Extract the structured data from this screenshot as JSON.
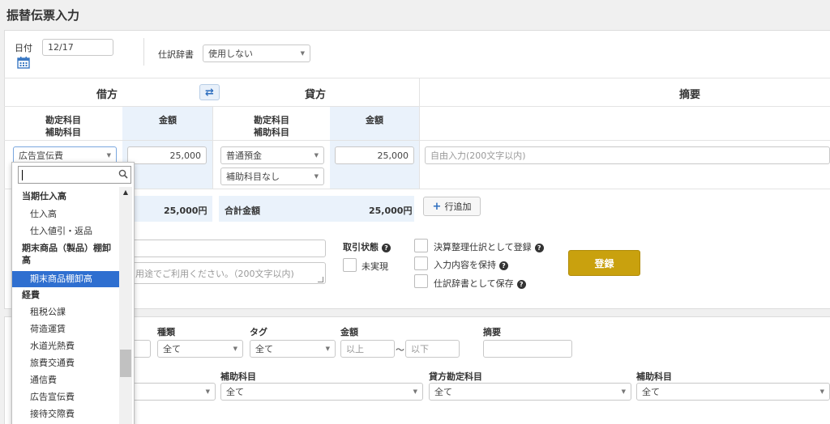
{
  "page_title": "振替伝票入力",
  "date_label": "日付",
  "date_value": "12/17",
  "dict_label": "仕訳辞書",
  "dict_value": "使用しない",
  "debit_header": "借方",
  "credit_header": "貸方",
  "memo_header": "摘要",
  "account_header_1": "勘定科目",
  "account_header_2": "補助科目",
  "amount_header": "金額",
  "debit_account": "広告宣伝費",
  "debit_amount": "25,000",
  "credit_account": "普通預金",
  "credit_sub": "補助科目なし",
  "credit_amount": "25,000",
  "memo_placeholder": "自由入力(200文字以内)",
  "total_debit": "25,000円",
  "total_label": "合計金額",
  "total_credit": "25,000円",
  "add_row": "行追加",
  "remark_placeholder": "用途でご利用ください。（200文字以内)",
  "status_label": "取引状態",
  "status_unsettled": "未実現",
  "opt_closing": "決算整理仕訳として登録",
  "opt_keep": "入力内容を保持",
  "opt_dict": "仕訳辞書として保存",
  "register": "登録",
  "filter": {
    "type_label": "種類",
    "type_value": "全て",
    "tag_label": "タグ",
    "tag_value": "全て",
    "amount_label": "金額",
    "amount_min": "以上",
    "amount_tilde": "〜",
    "amount_max": "以下",
    "memo_label": "摘要",
    "sub_label": "補助科目",
    "sub_value": "全て",
    "credit_account_label": "貸方勘定科目",
    "credit_account_value": "全て",
    "sub2_label": "補助科目",
    "sub2_value": "全て"
  },
  "dropdown": {
    "items": [
      {
        "kind": "group",
        "label": "当期仕入高"
      },
      {
        "kind": "opt",
        "label": "仕入高"
      },
      {
        "kind": "opt",
        "label": "仕入値引・返品"
      },
      {
        "kind": "group",
        "label": "期末商品（製品）棚卸"
      },
      {
        "kind": "group-cont",
        "label": "高"
      },
      {
        "kind": "sel",
        "label": "期末商品棚卸高"
      },
      {
        "kind": "group",
        "label": "経費"
      },
      {
        "kind": "opt",
        "label": "租税公課"
      },
      {
        "kind": "opt",
        "label": "荷造運賃"
      },
      {
        "kind": "opt",
        "label": "水道光熱費"
      },
      {
        "kind": "opt",
        "label": "旅費交通費"
      },
      {
        "kind": "opt",
        "label": "通信費"
      },
      {
        "kind": "opt",
        "label": "広告宣伝費"
      },
      {
        "kind": "opt",
        "label": "接待交際費"
      }
    ]
  }
}
